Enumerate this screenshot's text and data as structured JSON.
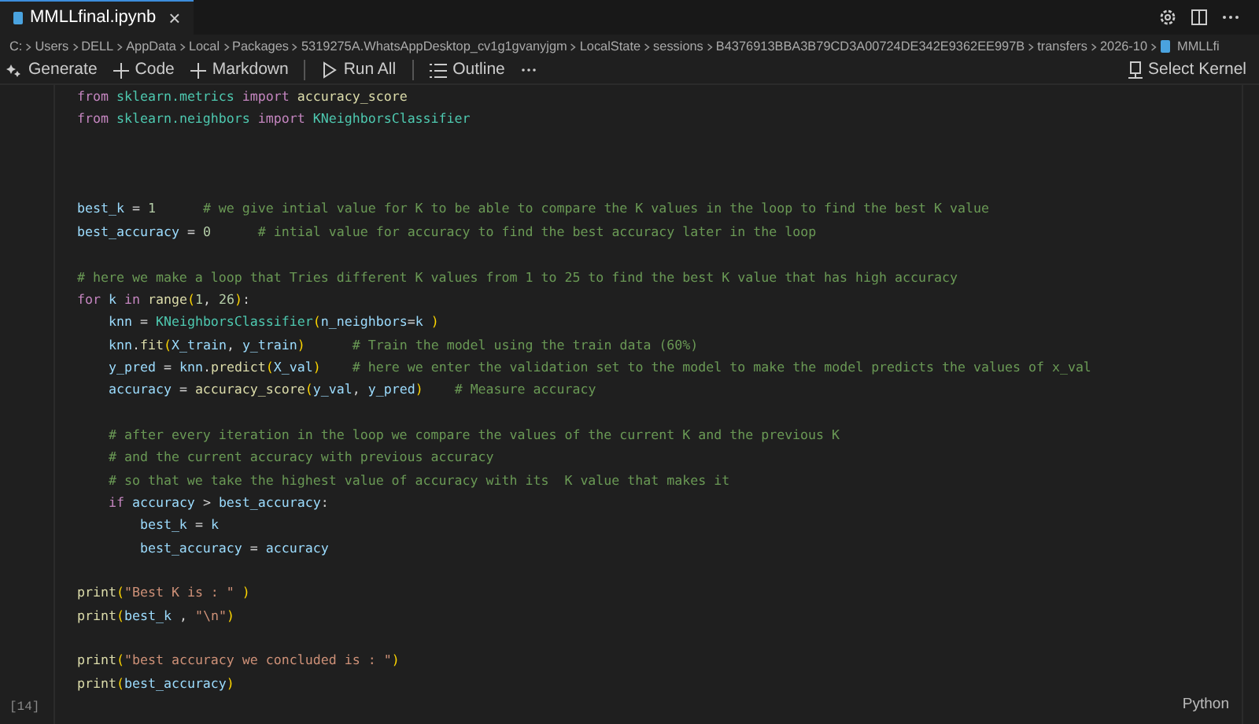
{
  "tab": {
    "title": "MMLLfinal.ipynb",
    "close": "×",
    "selected": true
  },
  "breadcrumb": [
    "C:",
    "Users",
    "DELL",
    "AppData",
    "Local",
    "Packages",
    "5319275A.WhatsAppDesktop_cv1g1gvanyjgm",
    "LocalState",
    "sessions",
    "B4376913BBA3B79CD3A00724DE342E9362EE997B",
    "transfers",
    "2026-10",
    "MMLLfi"
  ],
  "toolbar": [
    "Generate",
    "Code",
    "Markdown",
    "Run All",
    "Outline"
  ],
  "kernel": "Select Kernel",
  "cell": {
    "execution_count": "[14]",
    "language": "Python",
    "lines": [
      {
        "kind": "code",
        "tokens": [
          {
            "text": "from ",
            "kind": "kw"
          },
          {
            "text": "sklearn.metrics ",
            "kind": "mod"
          },
          {
            "text": "import ",
            "kind": "kw"
          },
          {
            "text": "accuracy_score",
            "kind": "fn"
          }
        ]
      },
      {
        "kind": "code",
        "tokens": [
          {
            "text": "from ",
            "kind": "kw"
          },
          {
            "text": "sklearn.neighbors ",
            "kind": "mod"
          },
          {
            "text": "import ",
            "kind": "kw"
          },
          {
            "text": "KNeighborsClassifier",
            "kind": "cls"
          }
        ]
      },
      {
        "kind": "blank"
      },
      {
        "kind": "blank"
      },
      {
        "kind": "blank"
      },
      {
        "kind": "code",
        "tokens": [
          {
            "text": "best_k ",
            "kind": "var"
          },
          {
            "text": "= ",
            "kind": "op"
          },
          {
            "text": "1",
            "kind": "num"
          },
          {
            "text": "      # we give intial value for K to be able to compare the K values in the loop to find the best K value",
            "kind": "cmt"
          }
        ]
      },
      {
        "kind": "code",
        "tokens": [
          {
            "text": "best_accuracy ",
            "kind": "var"
          },
          {
            "text": "= ",
            "kind": "op"
          },
          {
            "text": "0",
            "kind": "num"
          },
          {
            "text": "      # intial value for accuracy to find the best accuracy later in the loop",
            "kind": "cmt"
          }
        ]
      },
      {
        "kind": "blank"
      },
      {
        "kind": "code",
        "tokens": [
          {
            "text": "# here we make a loop that Tries different K values from 1 to 25 to find the best K value that has high accuracy",
            "kind": "cmt"
          }
        ]
      },
      {
        "kind": "code",
        "tokens": [
          {
            "text": "for ",
            "kind": "kw"
          },
          {
            "text": "k ",
            "kind": "var"
          },
          {
            "text": "in ",
            "kind": "kw"
          },
          {
            "text": "range",
            "kind": "fn"
          },
          {
            "text": "(",
            "kind": "br"
          },
          {
            "text": "1",
            "kind": "num"
          },
          {
            "text": ", ",
            "kind": "op"
          },
          {
            "text": "26",
            "kind": "num"
          },
          {
            "text": ")",
            "kind": "br"
          },
          {
            "text": ":",
            "kind": "op"
          }
        ]
      },
      {
        "kind": "code",
        "tokens": [
          {
            "text": "    knn ",
            "kind": "var"
          },
          {
            "text": "= ",
            "kind": "op"
          },
          {
            "text": "KNeighborsClassifier",
            "kind": "cls"
          },
          {
            "text": "(",
            "kind": "br"
          },
          {
            "text": "n_neighbors",
            "kind": "var"
          },
          {
            "text": "=",
            "kind": "op"
          },
          {
            "text": "k ",
            "kind": "var"
          },
          {
            "text": ")",
            "kind": "br"
          }
        ]
      },
      {
        "kind": "code",
        "tokens": [
          {
            "text": "    knn",
            "kind": "var"
          },
          {
            "text": ".",
            "kind": "op"
          },
          {
            "text": "fit",
            "kind": "fn"
          },
          {
            "text": "(",
            "kind": "br"
          },
          {
            "text": "X_train",
            "kind": "var"
          },
          {
            "text": ", ",
            "kind": "op"
          },
          {
            "text": "y_train",
            "kind": "var"
          },
          {
            "text": ")",
            "kind": "br"
          },
          {
            "text": "      # Train the model using the train data (60%)",
            "kind": "cmt"
          }
        ]
      },
      {
        "kind": "code",
        "tokens": [
          {
            "text": "    y_pred ",
            "kind": "var"
          },
          {
            "text": "= ",
            "kind": "op"
          },
          {
            "text": "knn",
            "kind": "var"
          },
          {
            "text": ".",
            "kind": "op"
          },
          {
            "text": "predict",
            "kind": "fn"
          },
          {
            "text": "(",
            "kind": "br"
          },
          {
            "text": "X_val",
            "kind": "var"
          },
          {
            "text": ")",
            "kind": "br"
          },
          {
            "text": "    # here we enter the validation set to the model to make the model predicts the values of x_val",
            "kind": "cmt"
          }
        ]
      },
      {
        "kind": "code",
        "tokens": [
          {
            "text": "    accuracy ",
            "kind": "var"
          },
          {
            "text": "= ",
            "kind": "op"
          },
          {
            "text": "accuracy_score",
            "kind": "fn"
          },
          {
            "text": "(",
            "kind": "br"
          },
          {
            "text": "y_val",
            "kind": "var"
          },
          {
            "text": ", ",
            "kind": "op"
          },
          {
            "text": "y_pred",
            "kind": "var"
          },
          {
            "text": ")",
            "kind": "br"
          },
          {
            "text": "    # Measure accuracy",
            "kind": "cmt"
          }
        ]
      },
      {
        "kind": "blank"
      },
      {
        "kind": "code",
        "tokens": [
          {
            "text": "    # after every iteration in the loop we compare the values of the current K and the previous K",
            "kind": "cmt"
          }
        ]
      },
      {
        "kind": "code",
        "tokens": [
          {
            "text": "    # and the current accuracy with previous accuracy",
            "kind": "cmt"
          }
        ]
      },
      {
        "kind": "code",
        "tokens": [
          {
            "text": "    # so that we take the highest value of accuracy with its  K value that makes it",
            "kind": "cmt"
          }
        ]
      },
      {
        "kind": "code",
        "tokens": [
          {
            "text": "    if ",
            "kind": "kw"
          },
          {
            "text": "accuracy ",
            "kind": "var"
          },
          {
            "text": "> ",
            "kind": "op"
          },
          {
            "text": "best_accuracy",
            "kind": "var"
          },
          {
            "text": ":",
            "kind": "op"
          }
        ]
      },
      {
        "kind": "code",
        "tokens": [
          {
            "text": "        best_k ",
            "kind": "var"
          },
          {
            "text": "= ",
            "kind": "op"
          },
          {
            "text": "k",
            "kind": "var"
          }
        ]
      },
      {
        "kind": "code",
        "tokens": [
          {
            "text": "        best_accuracy ",
            "kind": "var"
          },
          {
            "text": "= ",
            "kind": "op"
          },
          {
            "text": "accuracy",
            "kind": "var"
          }
        ]
      },
      {
        "kind": "blank"
      },
      {
        "kind": "code",
        "tokens": [
          {
            "text": "print",
            "kind": "fn"
          },
          {
            "text": "(",
            "kind": "br"
          },
          {
            "text": "\"Best K is : \" ",
            "kind": "str"
          },
          {
            "text": ")",
            "kind": "br"
          }
        ]
      },
      {
        "kind": "code",
        "tokens": [
          {
            "text": "print",
            "kind": "fn"
          },
          {
            "text": "(",
            "kind": "br"
          },
          {
            "text": "best_k ",
            "kind": "var"
          },
          {
            "text": ", ",
            "kind": "op"
          },
          {
            "text": "\"\\n\"",
            "kind": "str"
          },
          {
            "text": ")",
            "kind": "br"
          }
        ]
      },
      {
        "kind": "blank"
      },
      {
        "kind": "code",
        "tokens": [
          {
            "text": "print",
            "kind": "fn"
          },
          {
            "text": "(",
            "kind": "br"
          },
          {
            "text": "\"best accuracy we concluded is : \"",
            "kind": "str"
          },
          {
            "text": ")",
            "kind": "br"
          }
        ]
      },
      {
        "kind": "code",
        "tokens": [
          {
            "text": "print",
            "kind": "fn"
          },
          {
            "text": "(",
            "kind": "br"
          },
          {
            "text": "best_accuracy",
            "kind": "var"
          },
          {
            "text": ")",
            "kind": "br"
          }
        ]
      }
    ]
  }
}
